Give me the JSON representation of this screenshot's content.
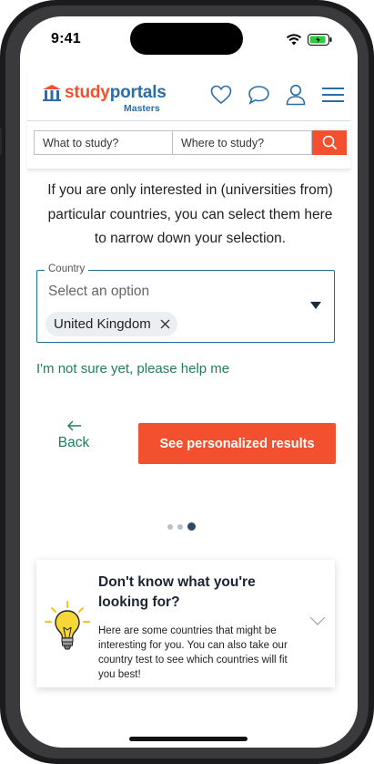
{
  "status": {
    "time": "9:41"
  },
  "header": {
    "logo_study": "study",
    "logo_portals": "portals",
    "logo_sub": "Masters"
  },
  "search": {
    "what_placeholder": "What to study?",
    "where_placeholder": "Where to study?"
  },
  "intro": "If you are only interested in (universities from) particular countries, you can select them here to narrow down your selection.",
  "country_select": {
    "legend": "Country",
    "placeholder": "Select an option",
    "selected": [
      "United Kingdom"
    ]
  },
  "help_link": "I'm not sure yet, please help me",
  "navigation": {
    "back_label": "Back",
    "cta_label": "See personalized results"
  },
  "pager": {
    "total": 3,
    "active": 3
  },
  "info_card": {
    "title": "Don't know what you're looking for?",
    "text": "Here are some countries that might be interesting for you. You can also take our country test to see which countries will fit you best!"
  },
  "colors": {
    "brand_orange": "#f2502f",
    "brand_blue": "#2a6da8",
    "link_green": "#1f7e5d",
    "select_border": "#1d6f8f"
  },
  "icons": [
    "heart-icon",
    "chat-icon",
    "user-icon",
    "menu-icon",
    "search-icon",
    "close-icon",
    "back-arrow-icon",
    "chevron-down-icon",
    "lightbulb-icon"
  ]
}
